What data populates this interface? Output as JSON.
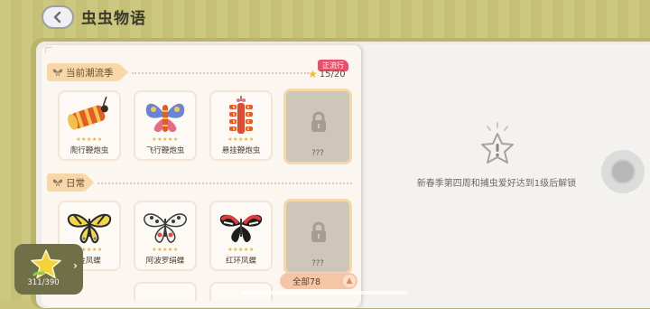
{
  "header": {
    "title": "虫虫物语"
  },
  "left_page": {
    "sections": [
      {
        "title": "当前潮流季",
        "badge": "正流行",
        "progress": "15/20",
        "cards": [
          {
            "name": "爬行鞭炮虫",
            "stars": "★★★★★",
            "art": "firecracker-crawler-icon",
            "locked": false
          },
          {
            "name": "飞行鞭炮虫",
            "stars": "★★★★★",
            "art": "firecracker-flyer-icon",
            "locked": false
          },
          {
            "name": "悬挂鞭炮虫",
            "stars": "★★★★★",
            "art": "firecracker-hanging-icon",
            "locked": false
          },
          {
            "name": "???",
            "stars": "",
            "art": "lock-icon",
            "locked": true
          }
        ]
      },
      {
        "title": "日常",
        "cards": [
          {
            "name": "金凤蝶",
            "stars": "★★★★★",
            "art": "swallowtail-butterfly-icon",
            "locked": false
          },
          {
            "name": "阿波罗绢蝶",
            "stars": "★★★★★",
            "art": "apollo-butterfly-icon",
            "locked": false
          },
          {
            "name": "红环凤蝶",
            "stars": "★★★★★",
            "art": "red-ring-butterfly-icon",
            "locked": false
          },
          {
            "name": "???",
            "stars": "",
            "art": "lock-icon",
            "locked": true
          }
        ]
      }
    ],
    "all_button": "全部78",
    "star_widget": {
      "count": "311/390"
    }
  },
  "right_page": {
    "unlock_message": "新春季第四周和捕虫爱好达到1级后解锁"
  },
  "colors": {
    "background": "#c9c47a",
    "accent_banner": "#f7d7a7",
    "badge": "#e8506a",
    "star": "#f2b418"
  }
}
